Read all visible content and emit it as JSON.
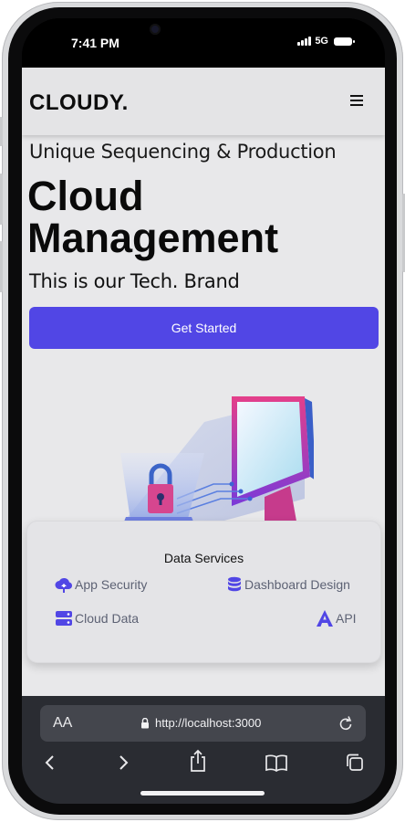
{
  "status": {
    "time": "7:41 PM",
    "network": "5G"
  },
  "nav": {
    "brand": "CLOUDY."
  },
  "hero": {
    "subtitle": "Unique Sequencing & Production",
    "title_line1": "Cloud",
    "title_line2": "Management",
    "tagline": "This is our Tech. Brand",
    "cta_label": "Get Started"
  },
  "services": {
    "title": "Data Services",
    "items": [
      {
        "label": "App Security",
        "icon": "cloud-upload-icon"
      },
      {
        "label": "Dashboard Design",
        "icon": "database-icon"
      },
      {
        "label": "Cloud Data",
        "icon": "server-icon"
      },
      {
        "label": "API",
        "icon": "angular-icon"
      }
    ]
  },
  "browser": {
    "text_size": "AA",
    "url": "http://localhost:3000"
  },
  "colors": {
    "accent": "#5146e5",
    "page_bg": "#e8e8ea",
    "service_text": "#5d6274"
  }
}
